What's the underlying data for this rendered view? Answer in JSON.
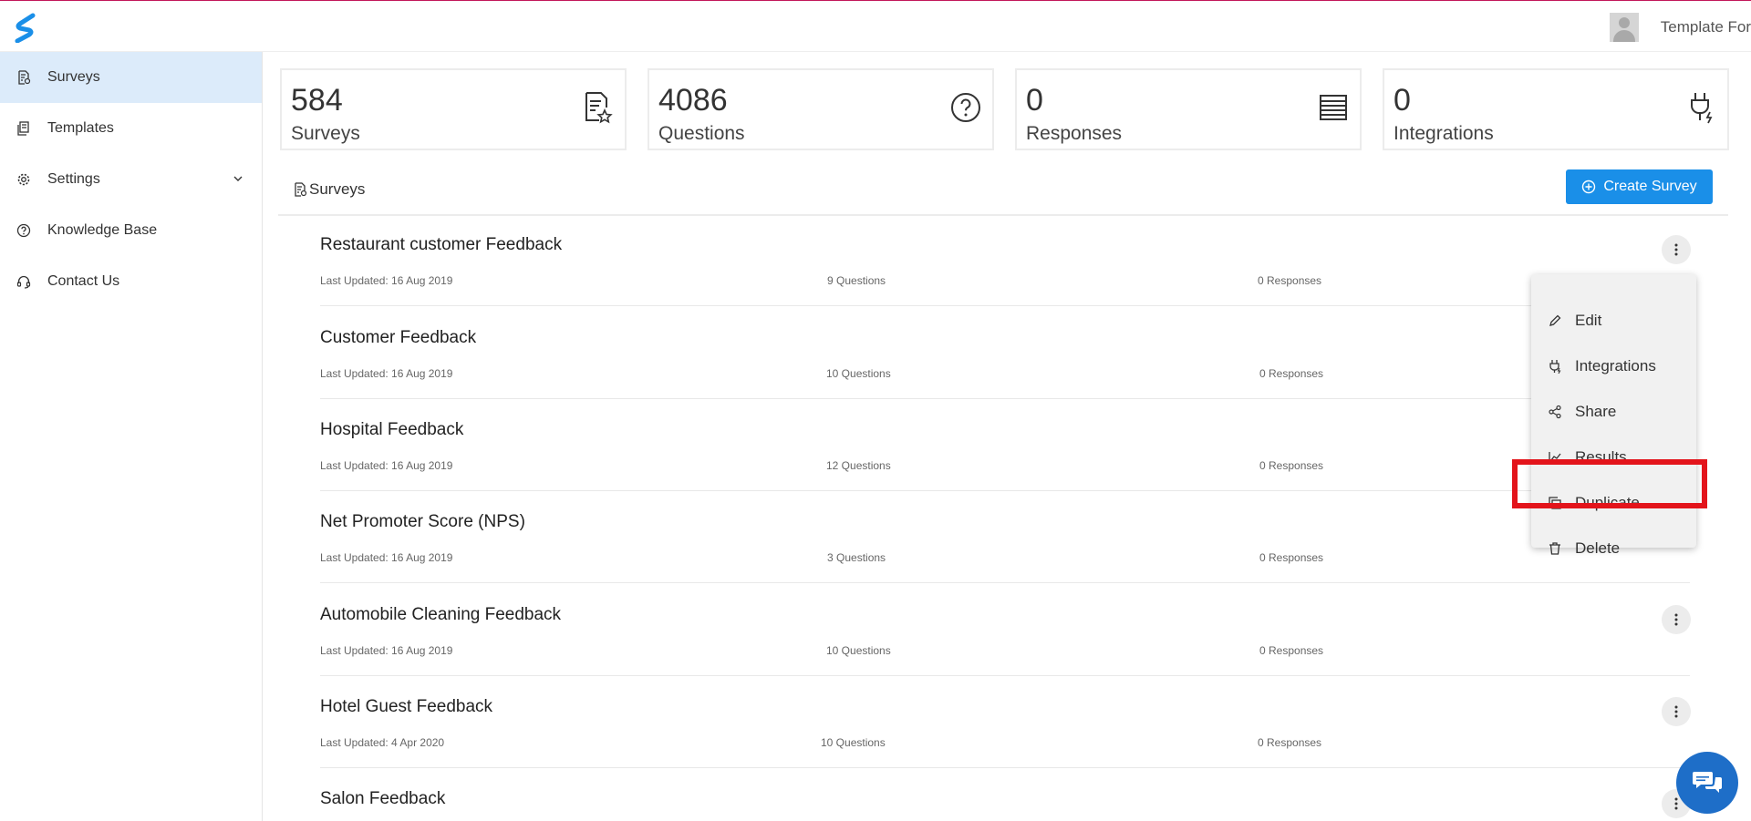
{
  "header": {
    "user_name": "Template For"
  },
  "sidebar": {
    "items": [
      {
        "label": "Surveys",
        "icon": "survey-doc-icon",
        "active": true
      },
      {
        "label": "Templates",
        "icon": "templates-icon"
      },
      {
        "label": "Settings",
        "icon": "gear-icon",
        "expandable": true
      },
      {
        "label": "Knowledge Base",
        "icon": "question-circle-icon"
      },
      {
        "label": "Contact Us",
        "icon": "headset-icon"
      }
    ]
  },
  "stats": [
    {
      "value": "584",
      "label": "Surveys",
      "icon": "survey-star-icon"
    },
    {
      "value": "4086",
      "label": "Questions",
      "icon": "question-circle-icon"
    },
    {
      "value": "0",
      "label": "Responses",
      "icon": "list-icon"
    },
    {
      "value": "0",
      "label": "Integrations",
      "icon": "plug-icon"
    }
  ],
  "section": {
    "title": "Surveys",
    "create_label": "Create Survey"
  },
  "surveys": [
    {
      "name": "Restaurant customer Feedback",
      "updated": "Last Updated: 16 Aug 2019",
      "questions": "9 Questions",
      "responses": "0 Responses"
    },
    {
      "name": "Customer Feedback",
      "updated": "Last Updated: 16 Aug 2019",
      "questions": "10 Questions",
      "responses": "0 Responses"
    },
    {
      "name": "Hospital Feedback",
      "updated": "Last Updated: 16 Aug 2019",
      "questions": "12 Questions",
      "responses": "0 Responses"
    },
    {
      "name": "Net Promoter Score (NPS)",
      "updated": "Last Updated: 16 Aug 2019",
      "questions": "3 Questions",
      "responses": "0 Responses"
    },
    {
      "name": "Automobile Cleaning Feedback",
      "updated": "Last Updated: 16 Aug 2019",
      "questions": "10 Questions",
      "responses": "0 Responses"
    },
    {
      "name": "Hotel Guest Feedback",
      "updated": "Last Updated: 4 Apr 2020",
      "questions": "10 Questions",
      "responses": "0 Responses"
    },
    {
      "name": "Salon Feedback",
      "updated": "",
      "questions": "",
      "responses": ""
    }
  ],
  "menu": {
    "items": [
      {
        "label": "Edit",
        "icon": "pencil-icon"
      },
      {
        "label": "Integrations",
        "icon": "plug-icon"
      },
      {
        "label": "Share",
        "icon": "share-icon"
      },
      {
        "label": "Results",
        "icon": "chart-line-icon"
      },
      {
        "label": "Duplicate",
        "icon": "copy-icon",
        "highlighted": true
      },
      {
        "label": "Delete",
        "icon": "trash-icon"
      }
    ]
  },
  "colors": {
    "accent": "#1a8fe8",
    "highlight": "#e3141b",
    "active_nav": "#dcebfa",
    "chat": "#1e6ec8"
  }
}
